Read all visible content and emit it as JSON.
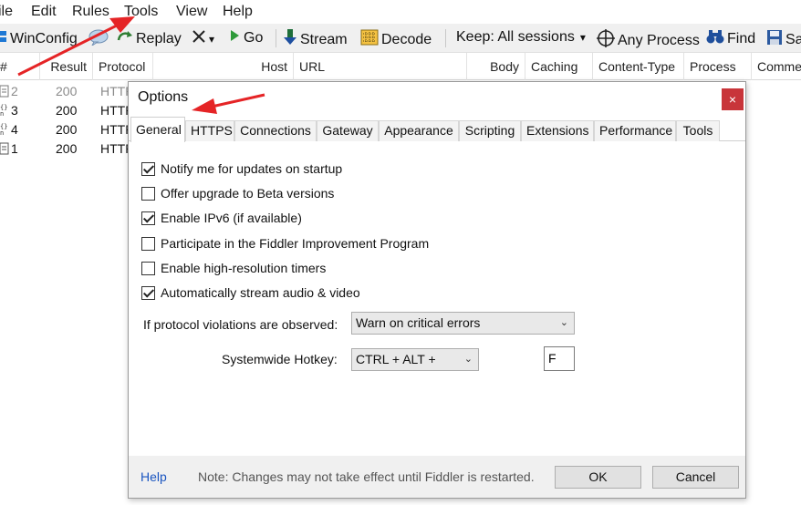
{
  "menu": {
    "items": [
      "ile",
      "Edit",
      "Rules",
      "Tools",
      "View",
      "Help"
    ]
  },
  "toolbar": {
    "winconfig": "WinConfig",
    "replay": "Replay",
    "remove_dropdown": "▾",
    "go": "Go",
    "stream": "Stream",
    "decode": "Decode",
    "keep": "Keep: All sessions",
    "keep_dropdown": "▾",
    "any_process": "Any Process",
    "find": "Find",
    "save": "Sa"
  },
  "grid": {
    "columns": [
      "#",
      "Result",
      "Protocol",
      "Host",
      "URL",
      "Body",
      "Caching",
      "Content-Type",
      "Process",
      "Commen"
    ],
    "rows": [
      {
        "id": "2",
        "result": "200",
        "protocol": "HTTP",
        "dimmed": true
      },
      {
        "id": "3",
        "result": "200",
        "protocol": "HTTP",
        "dimmed": false
      },
      {
        "id": "4",
        "result": "200",
        "protocol": "HTTP",
        "dimmed": false
      },
      {
        "id": "1",
        "result": "200",
        "protocol": "HTTP",
        "dimmed": false
      }
    ]
  },
  "dialog": {
    "title": "Options",
    "close": "×",
    "tabs": [
      "General",
      "HTTPS",
      "Connections",
      "Gateway",
      "Appearance",
      "Scripting",
      "Extensions",
      "Performance",
      "Tools"
    ],
    "active_tab": "General",
    "checkboxes": [
      {
        "label": "Notify me for updates on startup",
        "checked": true
      },
      {
        "label": "Offer upgrade to Beta versions",
        "checked": false
      },
      {
        "label": "Enable IPv6 (if available)",
        "checked": true
      },
      {
        "label": "Participate in the Fiddler Improvement Program",
        "checked": false
      },
      {
        "label": "Enable high-resolution timers",
        "checked": false
      },
      {
        "label": "Automatically stream audio & video",
        "checked": true
      }
    ],
    "protocol_label": "If protocol violations are observed:",
    "protocol_value": "Warn on critical errors",
    "hotkey_label": "Systemwide Hotkey:",
    "hotkey_value": "CTRL + ALT +",
    "hotkey_key": "F",
    "help": "Help",
    "note": "Note: Changes may not take effect until Fiddler is restarted.",
    "ok": "OK",
    "cancel": "Cancel"
  },
  "colors": {
    "accent_red": "#e52426",
    "close_red": "#c8353a",
    "help_blue": "#1a55c0"
  }
}
